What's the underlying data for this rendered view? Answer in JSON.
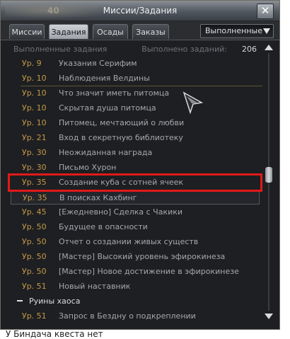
{
  "window": {
    "title": "Миссии/Задания",
    "title_badge": "40",
    "close_label": "✕"
  },
  "tabs": [
    {
      "label": "Миссии",
      "active": false
    },
    {
      "label": "Задания",
      "active": true
    },
    {
      "label": "Осады",
      "active": false
    },
    {
      "label": "Заказы",
      "active": false
    }
  ],
  "filter": {
    "selected": "Выполненные"
  },
  "header": {
    "left": "Выполненные задания",
    "right": "Выполнено заданий:",
    "count": "206"
  },
  "quests": [
    {
      "level": "Ур. 9",
      "name": "Указания Серифим"
    },
    {
      "level": "Ур. 10",
      "name": "Наблюдения Велдины"
    },
    {
      "level": "Ур. 10",
      "name": "Что значит иметь питомца"
    },
    {
      "level": "Ур. 10",
      "name": "Скрытая душа питомца"
    },
    {
      "level": "Ур. 10",
      "name": "Питомец, мечтающий о любви"
    },
    {
      "level": "Ур. 21",
      "name": "Вход в секретную библиотеку"
    },
    {
      "level": "Ур. 30",
      "name": "Неожиданная награда"
    },
    {
      "level": "Ур. 30",
      "name": "Письмо Хурон"
    },
    {
      "level": "Ур. 35",
      "name": "Создание куба с сотней ячеек"
    },
    {
      "level": "Ур. 35",
      "name": "В поисках Кахбинг"
    },
    {
      "level": "Ур. 45",
      "name": "[Ежедневно] Сделка с Чакики"
    },
    {
      "level": "Ур. 50",
      "name": "Будущее в опасности"
    },
    {
      "level": "Ур. 50",
      "name": "Отчет о создании живых существ"
    },
    {
      "level": "Ур. 50",
      "name": "[Мастер] Высокий уровень эфирокинеза"
    },
    {
      "level": "Ур. 50",
      "name": "[Мастер] Новое достижение в эфирокинезе"
    },
    {
      "level": "Ур. 51",
      "name": "Новый наставник"
    }
  ],
  "category": {
    "name": "Руины хаоса"
  },
  "last_quest": {
    "level": "Ур. 51",
    "name": "Запрос в Бездну о подкреплении"
  },
  "caption": "У Биндача квеста нет",
  "colors": {
    "highlight_box": "#e01a1a",
    "level_text": "#c39a4a"
  }
}
